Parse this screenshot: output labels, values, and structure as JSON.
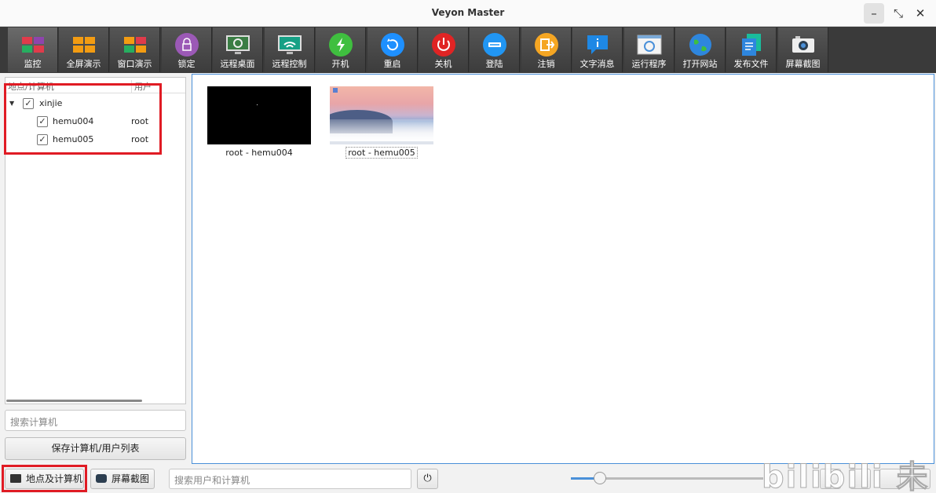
{
  "window": {
    "title": "Veyon Master"
  },
  "toolbar": [
    {
      "label": "监控",
      "icon": "monitor-grid-icon",
      "color": "#e03b4b"
    },
    {
      "label": "全屏演示",
      "icon": "fullscreen-demo-icon",
      "color": "#f39c12"
    },
    {
      "label": "窗口演示",
      "icon": "window-demo-icon",
      "color": "#27ae60"
    },
    {
      "label": "锁定",
      "icon": "lock-icon",
      "color": "#9b59b6"
    },
    {
      "label": "远程桌面",
      "icon": "remote-desktop-icon",
      "color": "#2ecc71"
    },
    {
      "label": "远程控制",
      "icon": "remote-control-icon",
      "color": "#16a085"
    },
    {
      "label": "开机",
      "icon": "power-on-icon",
      "color": "#3fbf3f"
    },
    {
      "label": "重启",
      "icon": "reboot-icon",
      "color": "#1e90ff"
    },
    {
      "label": "关机",
      "icon": "power-off-icon",
      "color": "#e02424"
    },
    {
      "label": "登陆",
      "icon": "login-icon",
      "color": "#2196f3"
    },
    {
      "label": "注销",
      "icon": "logout-icon",
      "color": "#f5a623"
    },
    {
      "label": "文字消息",
      "icon": "text-message-icon",
      "color": "#1e88e5"
    },
    {
      "label": "运行程序",
      "icon": "run-program-icon",
      "color": "#ffffff"
    },
    {
      "label": "打开网站",
      "icon": "open-website-icon",
      "color": "#2e86de"
    },
    {
      "label": "发布文件",
      "icon": "distribute-file-icon",
      "color": "#1abc9c"
    },
    {
      "label": "屏幕截图",
      "icon": "screenshot-icon",
      "color": "#eeeeee"
    }
  ],
  "tree": {
    "col_location": "地点/计算机",
    "col_user": "用户",
    "group": "xinjie",
    "computers": [
      {
        "name": "hemu004",
        "user": "root"
      },
      {
        "name": "hemu005",
        "user": "root"
      }
    ]
  },
  "left": {
    "search_placeholder": "搜索计算机",
    "save_label": "保存计算机/用户列表"
  },
  "main": {
    "tiles": [
      {
        "label": "root - hemu004"
      },
      {
        "label": "root - hemu005"
      }
    ]
  },
  "bottom": {
    "locations_label": "地点及计算机",
    "screenshot_label": "屏幕截图",
    "search_placeholder": "搜索用户和计算机",
    "zoom_fraction": 0.15
  },
  "watermark": "bilibili 未来AI",
  "colors": {
    "accent": "#4a90d9",
    "highlight_box": "#e01b24"
  }
}
